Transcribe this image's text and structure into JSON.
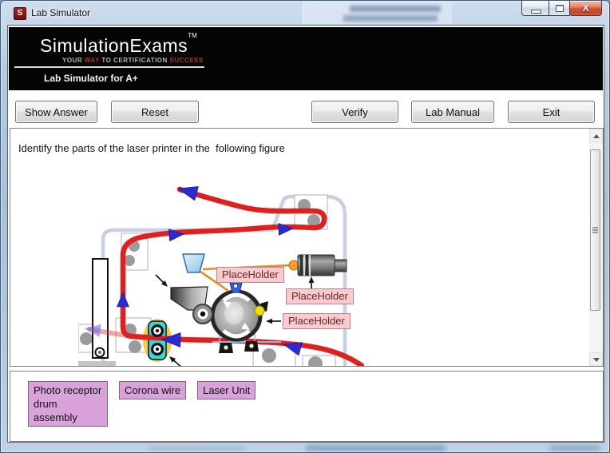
{
  "window": {
    "title": "Lab Simulator",
    "logo_letter": "S",
    "close_glyph": "X"
  },
  "banner": {
    "brand": "SimulationExams",
    "trademark": "TM",
    "tagline": {
      "p1": "YOUR",
      "p2": " WAY",
      "p3": " TO CERTIFICATION",
      "p4": " SUCCESS"
    },
    "product": "Lab Simulator for A+"
  },
  "toolbar": {
    "buttons": [
      "Show Answer",
      "Reset",
      "Verify",
      "Lab Manual",
      "Exit"
    ]
  },
  "question": "Identify the parts of the laser printer in the  following figure",
  "diagram": {
    "placeholders": [
      "PlaceHolder",
      "PlaceHolder",
      "PlaceHolder"
    ]
  },
  "answer_bank": {
    "labels": [
      "Photo receptor drum assembly",
      "Corona wire",
      "Laser Unit"
    ]
  },
  "colors": {
    "glass_blue": "#AFC6DE",
    "banner_bg": "#050505",
    "tagline_red": "#A93434",
    "paper_path_red": "#E01F1F",
    "arrow_blue": "#2A2ADB",
    "placeholder_bg": "#FBC9CE",
    "answer_label_bg": "#D9A2DB",
    "laser_beam_orange": "#E8891E",
    "fuser_teal": "#35D8D8",
    "fuser_glow": "#F9C63F",
    "printer_outline": "#C6D0E2"
  }
}
